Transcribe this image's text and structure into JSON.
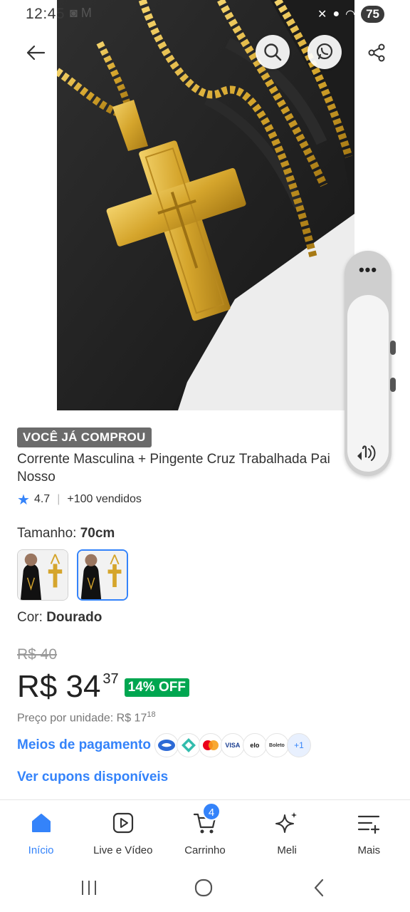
{
  "status_bar": {
    "time": "12:45",
    "battery": "75"
  },
  "product": {
    "badge": "VOCÊ JÁ COMPROU",
    "title": "Corrente Masculina + Pingente Cruz Trabalhada Pai Nosso",
    "rating": "4.7",
    "sold": "+100 vendidos",
    "size_label": "Tamanho:",
    "size_value": "70cm",
    "color_label": "Cor:",
    "color_value": "Dourado",
    "old_price": "R$ 40",
    "price": "R$ 34",
    "price_cents": "37",
    "discount": "14% OFF",
    "unit_price_label": "Preço por unidade: R$ 17",
    "unit_price_cents": "18",
    "payment_link": "Meios de pagamento",
    "payment_more": "+1",
    "payment_visa": "VISA",
    "payment_elo": "elo",
    "payment_boleto": "Boleto",
    "coupon_link": "Ver cupons disponíveis",
    "variants_selected_index": 1
  },
  "icons": {
    "back": "arrow-left-icon",
    "search": "search-icon",
    "whatsapp": "whatsapp-icon",
    "share": "share-icon",
    "speaker": "speaker-icon"
  },
  "bottom_nav": [
    {
      "label": "Início",
      "icon": "home-icon",
      "active": true
    },
    {
      "label": "Live e Vídeo",
      "icon": "play-icon",
      "active": false
    },
    {
      "label": "Carrinho",
      "icon": "cart-icon",
      "active": false,
      "badge": "4"
    },
    {
      "label": "Meli",
      "icon": "sparkle-icon",
      "active": false
    },
    {
      "label": "Mais",
      "icon": "menu-plus-icon",
      "active": false
    }
  ],
  "colors": {
    "accent": "#3483fa",
    "discount_green": "#00a650",
    "badge_gray": "#6b6b6b"
  }
}
